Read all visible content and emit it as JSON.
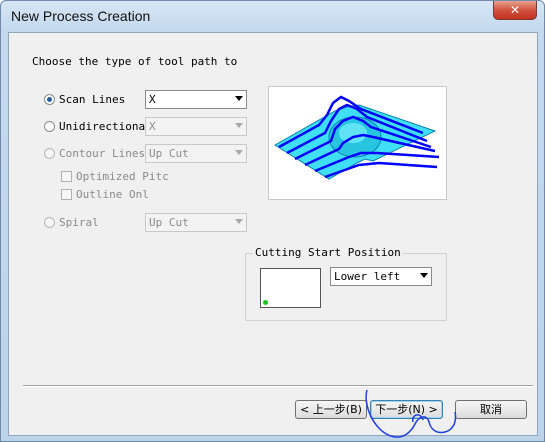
{
  "window": {
    "title": "New Process Creation",
    "close_label": "✕"
  },
  "prompt": "Choose the type of tool path to",
  "options": {
    "scan_lines": {
      "label": "Scan Lines",
      "value": "X"
    },
    "unidirectional": {
      "label": "Unidirectiona",
      "value": "X"
    },
    "contour_lines": {
      "label": "Contour Lines",
      "value": "Up Cut"
    },
    "optimized_pitch": {
      "label": "Optimized Pitc"
    },
    "outline_only": {
      "label": "Outline Onl"
    },
    "spiral": {
      "label": "Spiral",
      "value": "Up Cut"
    }
  },
  "cutting_start": {
    "title": "Cutting Start Position",
    "value": "Lower left"
  },
  "buttons": {
    "back": "< 上一步(B)",
    "next": "下一步(N) >",
    "cancel": "取消"
  },
  "colors": {
    "toolpath": "#0000ff",
    "surface": "#22d3ee",
    "start_marker": "#1ec21e"
  }
}
